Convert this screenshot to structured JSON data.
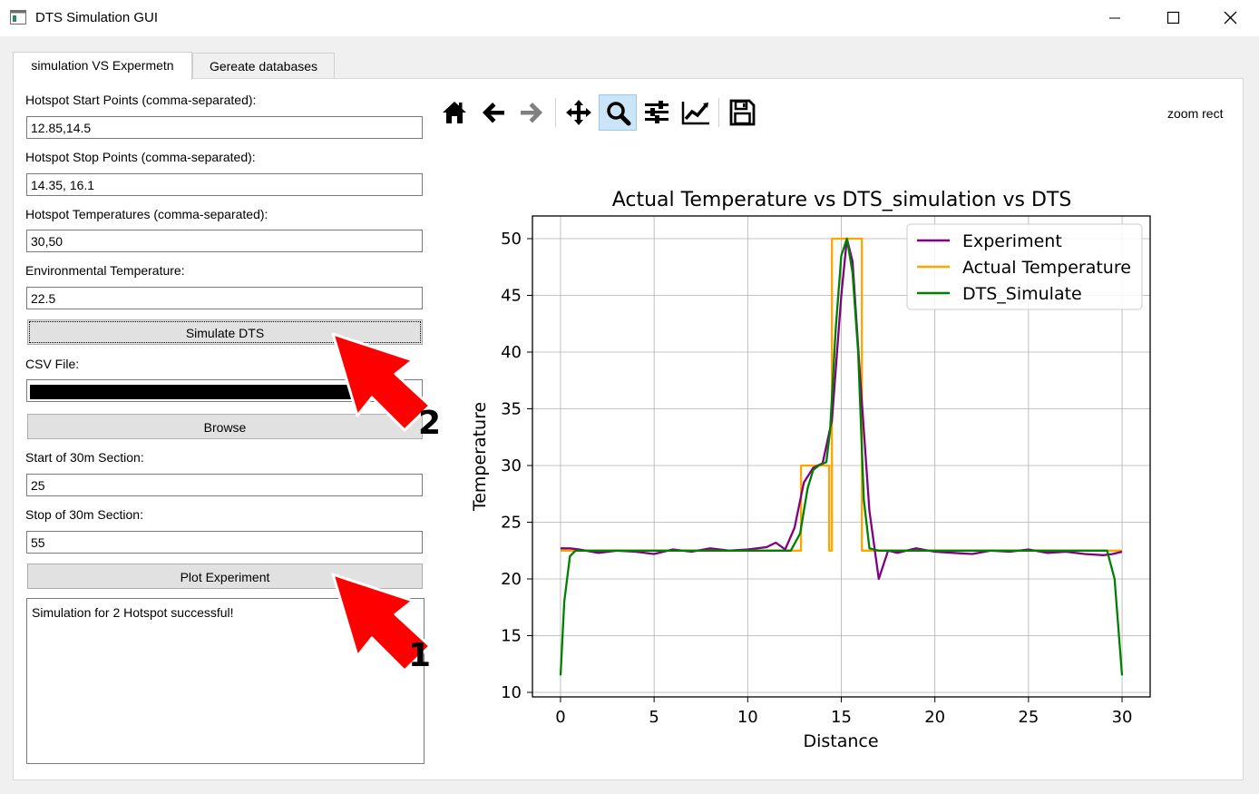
{
  "window": {
    "title": "DTS Simulation GUI",
    "icon": "app-window-icon"
  },
  "tabs": [
    {
      "label": "simulation VS Expermetn",
      "active": true
    },
    {
      "label": "Gereate databases",
      "active": false
    }
  ],
  "form": {
    "start_points": {
      "label": "Hotspot Start Points (comma-separated):",
      "value": "12.85,14.5"
    },
    "stop_points": {
      "label": "Hotspot Stop Points (comma-separated):",
      "value": "14.35, 16.1"
    },
    "temperatures": {
      "label": "Hotspot Temperatures (comma-separated):",
      "value": "30,50"
    },
    "env_temp": {
      "label": "Environmental Temperature:",
      "value": "22.5"
    },
    "simulate_button": "Simulate DTS",
    "csv_file": {
      "label": "CSV File:",
      "value": ""
    },
    "browse_button": "Browse",
    "section_start": {
      "label": "Start of 30m Section:",
      "value": "25"
    },
    "section_stop": {
      "label": "Stop of 30m Section:",
      "value": "55"
    },
    "plot_button": "Plot Experiment",
    "log_text": "Simulation for 2 Hotspot successful!"
  },
  "toolbar": {
    "icons": [
      "home-icon",
      "back-arrow-icon",
      "forward-arrow-icon",
      "pan-icon",
      "zoom-icon",
      "subplots-icon",
      "customize-icon",
      "save-icon"
    ],
    "active": "zoom-icon",
    "mode_text": "zoom rect"
  },
  "annotations": [
    {
      "number": "2",
      "color": "#ff0000",
      "points_to": "Simulate DTS"
    },
    {
      "number": "1",
      "color": "#ff0000",
      "points_to": "Plot Experiment"
    }
  ],
  "chart_data": {
    "type": "line",
    "title": "Actual Temperature vs DTS_simulation vs DTS",
    "xlabel": "Distance",
    "ylabel": "Temperature",
    "xlim": [
      -1.5,
      31.5
    ],
    "ylim": [
      9.6,
      52
    ],
    "xticks": [
      0,
      5,
      10,
      15,
      20,
      25,
      30
    ],
    "yticks": [
      10,
      15,
      20,
      25,
      30,
      35,
      40,
      45,
      50
    ],
    "grid": true,
    "legend_position": "top-right",
    "series": [
      {
        "name": "Experiment",
        "color": "#800080",
        "x": [
          0,
          0.5,
          1,
          2,
          3,
          4,
          5,
          6,
          7,
          8,
          9,
          10,
          11,
          11.5,
          12,
          12.5,
          13,
          13.5,
          14,
          14.5,
          15,
          15.3,
          15.6,
          16,
          16.5,
          17,
          17.5,
          18,
          19,
          20,
          21,
          22,
          23,
          24,
          25,
          26,
          27,
          28,
          29,
          29.5,
          30
        ],
        "y": [
          22.7,
          22.7,
          22.6,
          22.3,
          22.5,
          22.4,
          22.2,
          22.6,
          22.4,
          22.7,
          22.5,
          22.6,
          22.8,
          23.2,
          22.6,
          24.5,
          28.5,
          29.8,
          30.2,
          34,
          45,
          50,
          48,
          38,
          26,
          20,
          22.5,
          22.3,
          22.7,
          22.4,
          22.3,
          22.2,
          22.5,
          22.4,
          22.6,
          22.3,
          22.4,
          22.2,
          22.1,
          22.2,
          22.4
        ]
      },
      {
        "name": "Actual Temperature",
        "color": "#ffa500",
        "x": [
          0,
          12.85,
          12.85,
          14.35,
          14.35,
          14.5,
          14.5,
          16.1,
          16.1,
          30
        ],
        "y": [
          22.5,
          22.5,
          30,
          30,
          22.5,
          22.5,
          50,
          50,
          22.5,
          22.5
        ]
      },
      {
        "name": "DTS_Simulate",
        "color": "#008000",
        "x": [
          0,
          0.2,
          0.5,
          0.8,
          1,
          2,
          5,
          10,
          12.3,
          12.8,
          13.2,
          13.5,
          13.8,
          14.2,
          14.4,
          14.7,
          15,
          15.3,
          15.6,
          15.9,
          16.2,
          16.5,
          17,
          20,
          25,
          29.2,
          29.6,
          30
        ],
        "y": [
          11.5,
          18,
          22,
          22.5,
          22.5,
          22.5,
          22.5,
          22.5,
          22.5,
          24,
          28,
          29.6,
          30,
          30.3,
          33,
          42,
          48.5,
          50,
          47,
          40,
          27,
          22.7,
          22.5,
          22.5,
          22.5,
          22.5,
          20,
          11.5
        ]
      }
    ]
  }
}
